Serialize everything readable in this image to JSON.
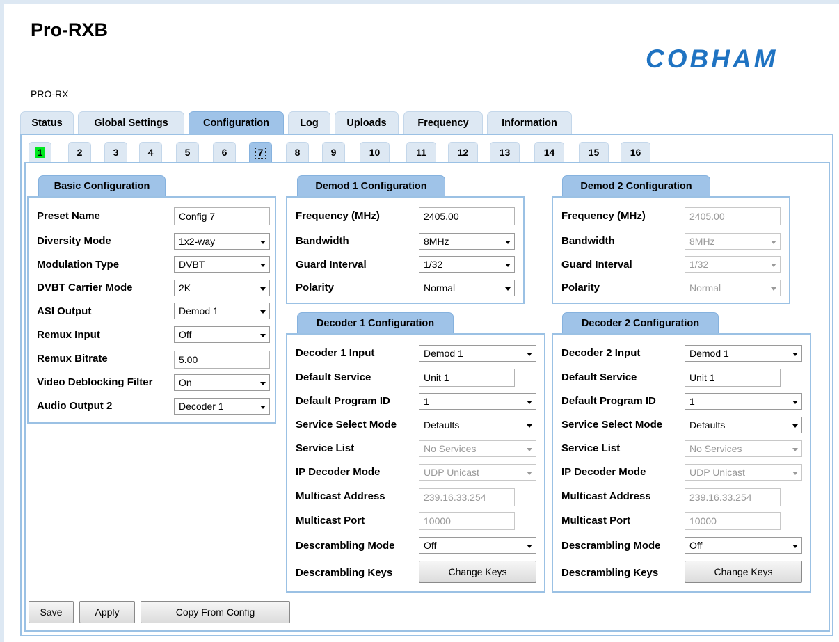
{
  "app": {
    "title": "Pro-RXB",
    "logo": "COBHAM",
    "subtitle": "PRO-RX"
  },
  "tabs": [
    "Status",
    "Global Settings",
    "Configuration",
    "Log",
    "Uploads",
    "Frequency",
    "Information"
  ],
  "active_tab": "Configuration",
  "presets": [
    "1",
    "2",
    "3",
    "4",
    "5",
    "6",
    "7",
    "8",
    "9",
    "10",
    "11",
    "12",
    "13",
    "14",
    "15",
    "16"
  ],
  "active_preset": "7",
  "basic": {
    "title": "Basic Configuration",
    "preset_name": {
      "label": "Preset Name",
      "value": "Config 7"
    },
    "diversity_mode": {
      "label": "Diversity Mode",
      "value": "1x2-way"
    },
    "modulation_type": {
      "label": "Modulation Type",
      "value": "DVBT"
    },
    "carrier_mode": {
      "label": "DVBT Carrier Mode",
      "value": "2K"
    },
    "asi_output": {
      "label": "ASI Output",
      "value": "Demod 1"
    },
    "remux_input": {
      "label": "Remux Input",
      "value": "Off"
    },
    "remux_bitrate": {
      "label": "Remux Bitrate",
      "value": "5.00"
    },
    "deblocking": {
      "label": "Video Deblocking Filter",
      "value": "On"
    },
    "audio_output_2": {
      "label": "Audio Output 2",
      "value": "Decoder 1"
    }
  },
  "demod1": {
    "title": "Demod 1 Configuration",
    "frequency": {
      "label": "Frequency (MHz)",
      "value": "2405.00"
    },
    "bandwidth": {
      "label": "Bandwidth",
      "value": "8MHz"
    },
    "guard": {
      "label": "Guard Interval",
      "value": "1/32"
    },
    "polarity": {
      "label": "Polarity",
      "value": "Normal"
    }
  },
  "demod2": {
    "title": "Demod 2 Configuration",
    "frequency": {
      "label": "Frequency (MHz)",
      "value": "2405.00"
    },
    "bandwidth": {
      "label": "Bandwidth",
      "value": "8MHz"
    },
    "guard": {
      "label": "Guard Interval",
      "value": "1/32"
    },
    "polarity": {
      "label": "Polarity",
      "value": "Normal"
    }
  },
  "decoder1": {
    "title": "Decoder 1 Configuration",
    "input": {
      "label": "Decoder 1 Input",
      "value": "Demod 1"
    },
    "default_service": {
      "label": "Default Service",
      "value": "Unit 1"
    },
    "program_id": {
      "label": "Default Program ID",
      "value": "1"
    },
    "select_mode": {
      "label": "Service Select Mode",
      "value": "Defaults"
    },
    "service_list": {
      "label": "Service List",
      "value": "No Services"
    },
    "ip_mode": {
      "label": "IP Decoder Mode",
      "value": "UDP Unicast"
    },
    "multicast_address": {
      "label": "Multicast Address",
      "value": "239.16.33.254"
    },
    "multicast_port": {
      "label": "Multicast Port",
      "value": "10000"
    },
    "descrambling_mode": {
      "label": "Descrambling Mode",
      "value": "Off"
    },
    "descrambling_keys": {
      "label": "Descrambling Keys",
      "button": "Change Keys"
    }
  },
  "decoder2": {
    "title": "Decoder 2 Configuration",
    "input": {
      "label": "Decoder 2 Input",
      "value": "Demod 1"
    },
    "default_service": {
      "label": "Default Service",
      "value": "Unit 1"
    },
    "program_id": {
      "label": "Default Program ID",
      "value": "1"
    },
    "select_mode": {
      "label": "Service Select Mode",
      "value": "Defaults"
    },
    "service_list": {
      "label": "Service List",
      "value": "No Services"
    },
    "ip_mode": {
      "label": "IP Decoder Mode",
      "value": "UDP Unicast"
    },
    "multicast_address": {
      "label": "Multicast Address",
      "value": "239.16.33.254"
    },
    "multicast_port": {
      "label": "Multicast Port",
      "value": "10000"
    },
    "descrambling_mode": {
      "label": "Descrambling Mode",
      "value": "Off"
    },
    "descrambling_keys": {
      "label": "Descrambling Keys",
      "button": "Change Keys"
    }
  },
  "actions": {
    "save": "Save",
    "apply": "Apply",
    "copy": "Copy From Config"
  },
  "colors": {
    "tab_bg": "#dde8f3",
    "tab_active": "#9fc3e8",
    "border": "#9bc1e4",
    "logo": "#1f73c2",
    "preset_indicator": "#00e81f"
  }
}
